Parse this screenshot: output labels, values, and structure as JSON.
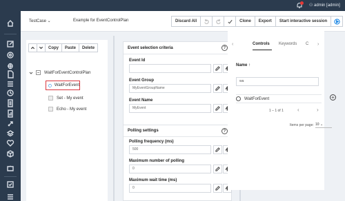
{
  "topbar": {
    "user": "admin [admin]",
    "notification_icon": "bell-icon",
    "user_icon": "user-icon"
  },
  "sidebar": {
    "icons": [
      "home-icon",
      "edit-icon",
      "at-sign-icon",
      "bug-icon",
      "file-icon",
      "list-icon",
      "clock-icon",
      "file-text-icon",
      "file-chart-icon",
      "rocket-icon",
      "layers-icon",
      "heart-pulse-icon",
      "box-icon",
      "puzzle-icon",
      "checkbox-icon",
      "menu-icon"
    ]
  },
  "header": {
    "type_select": "TestCase ⌄",
    "title": "Example for EventControlPlan",
    "buttons": {
      "discard_all": "Discard All",
      "clone": "Clone",
      "export": "Export",
      "start_session": "Start interactive session"
    }
  },
  "tree": {
    "tools": {
      "copy": "Copy",
      "paste": "Paste",
      "delete": "Delete"
    },
    "root": "WaitForEventControlPlan",
    "selected": "WaitForEvent",
    "children": [
      "Set - My event",
      "Echo - My event"
    ]
  },
  "event_section": {
    "title": "Event selection criteria",
    "event_id": {
      "label": "Event Id",
      "value": ""
    },
    "event_group": {
      "label": "Event Group",
      "placeholder": "MyEventGroupName"
    },
    "event_name": {
      "label": "Event Name",
      "placeholder": "MyEvent"
    }
  },
  "polling_section": {
    "title": "Polling settings",
    "frequency": {
      "label": "Polling frequency (ms)",
      "value": "500"
    },
    "max_polling": {
      "label": "Maximum number of polling",
      "value": "0"
    },
    "max_wait": {
      "label": "Maximum wait time (ms)",
      "value": "0"
    }
  },
  "right": {
    "tabs": [
      "Controls",
      "Keywords",
      "C"
    ],
    "column_header": "Name ↑",
    "search_value": "wa",
    "row": "WaitForEvent",
    "pagination": "1 – 1 of 1",
    "items_per_page_label": "Items per page:",
    "items_per_page_value": "10"
  }
}
